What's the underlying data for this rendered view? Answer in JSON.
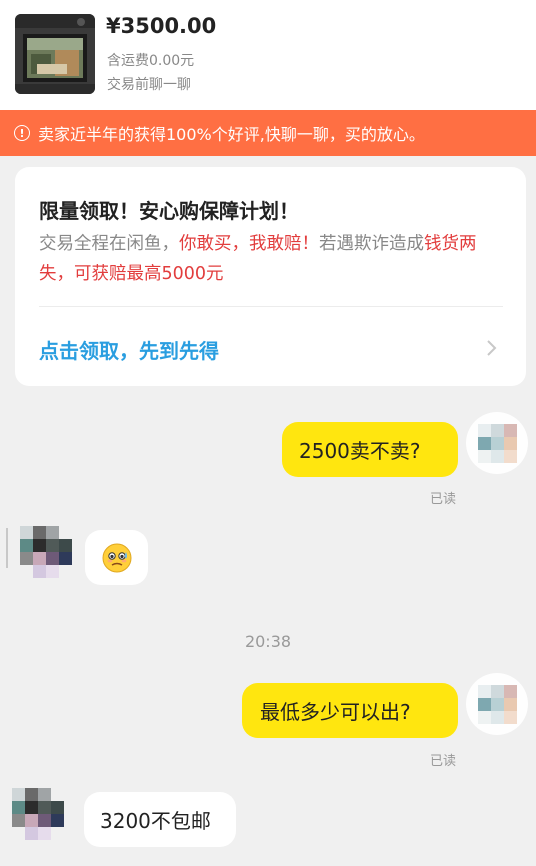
{
  "product": {
    "price": "¥3500.00",
    "shipping": "含运费0.00元",
    "chat_note": "交易前聊一聊"
  },
  "alert": {
    "text": "卖家近半年的获得100%个好评,快聊一聊，买的放心。",
    "icon": "info-icon"
  },
  "promo": {
    "title": "限量领取！安心购保障计划！",
    "body_part1": "交易全程在闲鱼，",
    "body_part2": "你敢买，我敢赔！",
    "body_part3": "若遇欺诈造成",
    "body_part4": "钱货两失，可获赔最高5000元",
    "link": "点击领取，先到先得",
    "accent_red": "#e23d3d",
    "accent_blue": "#2a9ee0"
  },
  "messages": [
    {
      "side": "me",
      "text": "2500卖不卖?",
      "status": "已读"
    },
    {
      "side": "other",
      "type": "emoji",
      "emoji": "🥲",
      "icon": "anxious-face-emoji"
    },
    {
      "time": "20:38"
    },
    {
      "side": "me",
      "text": "最低多少可以出?",
      "status": "已读"
    },
    {
      "side": "other",
      "text": "3200不包邮"
    }
  ],
  "colors": {
    "alert_bg": "#ff6f43",
    "my_bubble": "#ffe60f",
    "background": "#f0f0f0"
  }
}
